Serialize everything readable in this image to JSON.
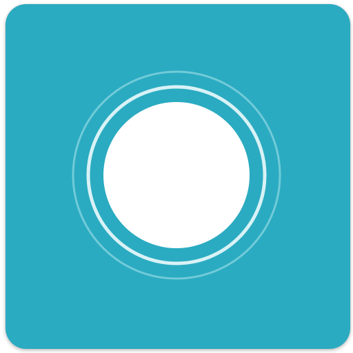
{
  "icon": {
    "name": "voice-assistant-ring-icon",
    "background_color": "#2AABC1",
    "outer_ring_color": "#7FD0DD",
    "inner_ring_color": "#D8F2F6",
    "center_color": "#FFFFFF"
  }
}
